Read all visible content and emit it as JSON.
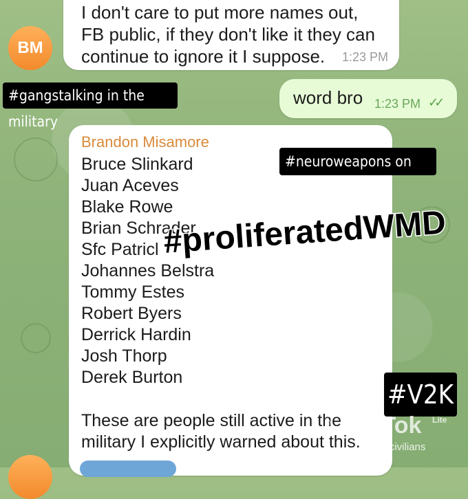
{
  "chat": {
    "message_1": {
      "avatar_initials": "BM",
      "lines": [
        "I don't care to put more names out,",
        "FB public, if they don't like it they can",
        "continue to ignore it I suppose."
      ],
      "time": "1:23 PM"
    },
    "outgoing": {
      "text": "word bro",
      "time": "1:23 PM",
      "status_icon": "double-check-icon"
    },
    "message_2": {
      "sender": "Brandon Misamore",
      "names": [
        "Bruce Slinkard",
        "Juan Aceves",
        "Blake Rowe",
        "Brian Schrader",
        "Sfc Patricl",
        "Johannes Belstra",
        "Tommy Estes",
        "Robert Byers",
        "Derrick Hardin",
        "Josh Thorp",
        "Derek Burton"
      ],
      "footer_lines": [
        "These are people still active in the",
        "military I explicitly warned about this."
      ]
    }
  },
  "overlays": {
    "tag_1": "#gangstalking in the military",
    "tag_2": "#neuroweapons on base",
    "tag_3": "#V2K",
    "big_tag": "#proliferatedWMD"
  },
  "watermark": {
    "brand": "TikTok",
    "lite": "Lite",
    "handle": "uscivilians"
  },
  "colors": {
    "background": "#8fb37a",
    "sender_name": "#d98a3a",
    "outgoing_bubble": "#e7fcd6",
    "avatar": "#f28a2c"
  }
}
